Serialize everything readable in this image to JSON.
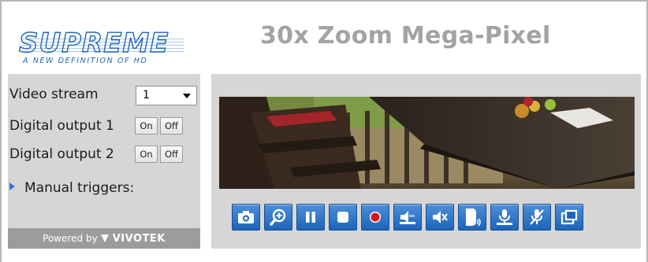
{
  "brand": {
    "logo_text": "SUPREME",
    "logo_tagline": "A NEW DEFINITION OF HD",
    "accent_color": "#1f66b8"
  },
  "header": {
    "title": "30x  Zoom Mega-Pixel"
  },
  "controls": {
    "video_stream_label": "Video stream",
    "video_stream_value": "1",
    "digital_output_1_label": "Digital output 1",
    "digital_output_2_label": "Digital output 2",
    "on_label": "On",
    "off_label": "Off",
    "manual_triggers_label": "Manual triggers:"
  },
  "footer": {
    "powered_by": "Powered by",
    "vendor": "VIVOTEK"
  },
  "toolbar": {
    "buttons": [
      {
        "icon": "camera-icon"
      },
      {
        "icon": "zoom-in-icon"
      },
      {
        "icon": "pause-icon"
      },
      {
        "icon": "stop-icon"
      },
      {
        "icon": "record-icon"
      },
      {
        "icon": "speaker-icon"
      },
      {
        "icon": "speaker-mute-icon"
      },
      {
        "icon": "talk-icon"
      },
      {
        "icon": "microphone-icon"
      },
      {
        "icon": "microphone-mute-icon"
      },
      {
        "icon": "fullscreen-icon"
      }
    ]
  }
}
